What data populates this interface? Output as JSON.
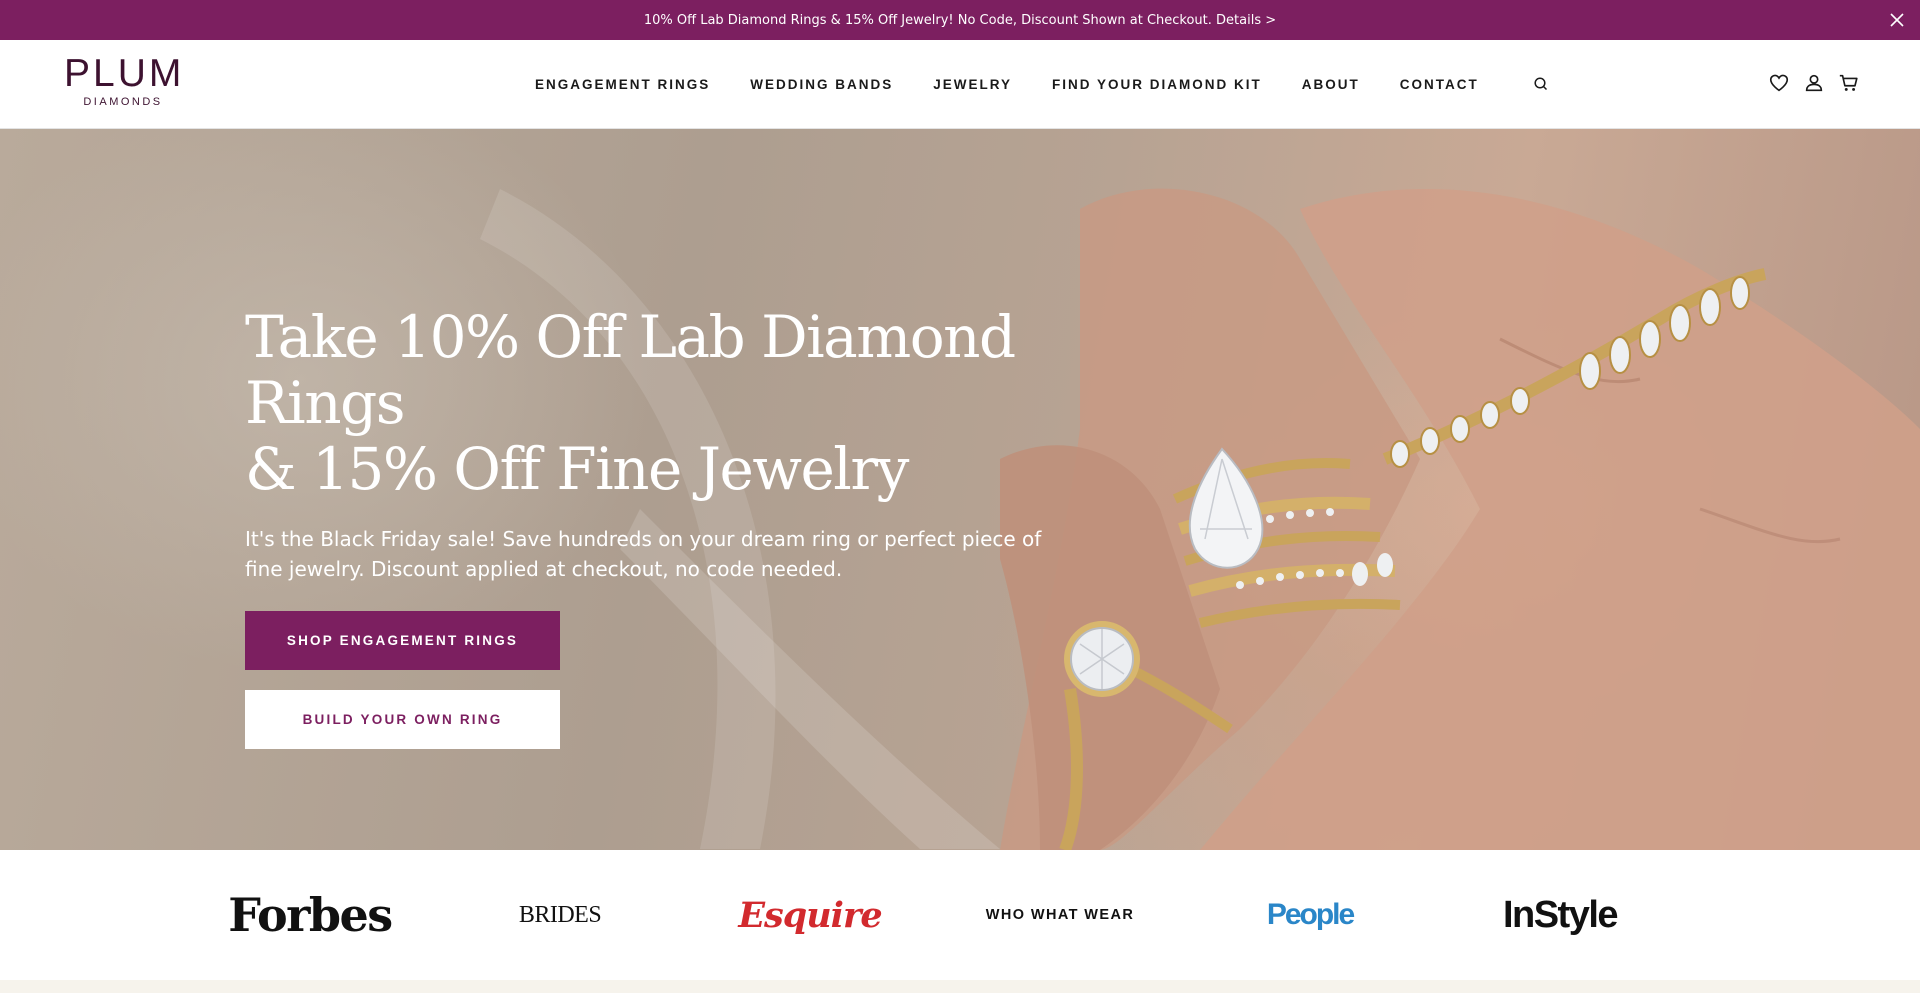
{
  "promo": {
    "text": "10% Off Lab Diamond Rings & 15% Off Jewelry! No Code, Discount Shown at Checkout. Details >",
    "close_icon": "close-icon"
  },
  "header": {
    "logo_main": "PLUM",
    "logo_sub": "DIAMONDS",
    "nav": [
      {
        "label": "ENGAGEMENT RINGS"
      },
      {
        "label": "WEDDING BANDS"
      },
      {
        "label": "JEWELRY"
      },
      {
        "label": "FIND YOUR DIAMOND KIT"
      },
      {
        "label": "ABOUT"
      },
      {
        "label": "CONTACT"
      }
    ],
    "icons": [
      "search-icon",
      "heart-icon",
      "account-icon",
      "cart-icon"
    ]
  },
  "hero": {
    "title_line1": "Take 10% Off Lab Diamond Rings",
    "title_line2": "& 15% Off Fine Jewelry",
    "subtitle": "It's the Black Friday sale! Save hundreds on your dream ring or perfect piece of fine jewelry. Discount applied at checkout, no code needed.",
    "primary_button": "SHOP ENGAGEMENT RINGS",
    "secondary_button": "BUILD YOUR OWN RING"
  },
  "press": {
    "logos": [
      "Forbes",
      "BRIDES",
      "Esquire",
      "WHO WHAT WEAR",
      "People",
      "InStyle"
    ]
  },
  "colors": {
    "brand": "#7c1f60",
    "logo_dark": "#3d1230",
    "esquire_red": "#d22a2e",
    "people_blue": "#2a86c8"
  }
}
